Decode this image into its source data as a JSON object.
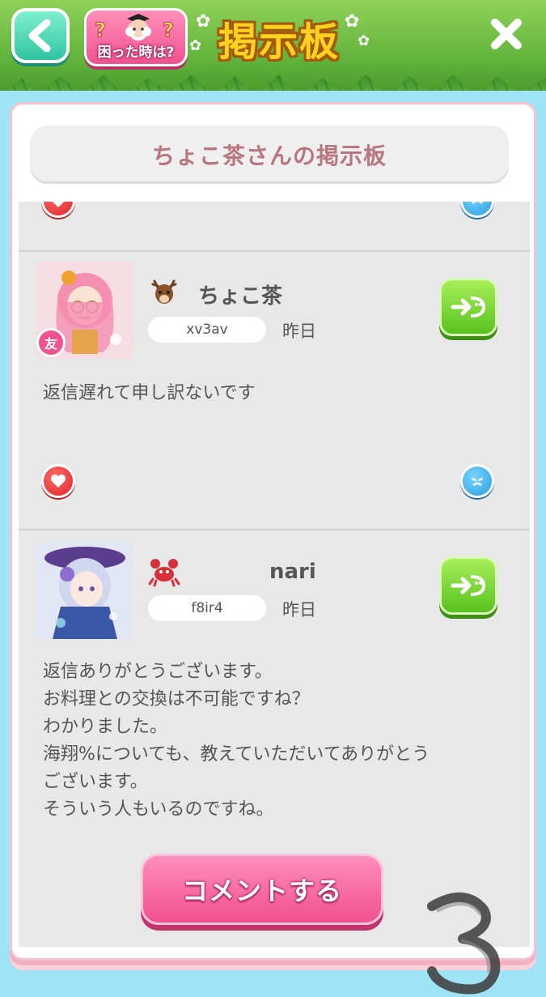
{
  "header": {
    "help_label": "困った時は?",
    "title": "掲示板"
  },
  "panel": {
    "title": "ちょこ茶さんの掲示板"
  },
  "posts": [
    {
      "username": "ちょこ茶",
      "user_id": "xv3av",
      "timestamp": "昨日",
      "friend_badge": "友",
      "zodiac_icon": "deer-icon",
      "message": "返信遅れて申し訳ないです"
    },
    {
      "username": "nari",
      "user_id": "f8ir4",
      "timestamp": "昨日",
      "zodiac_icon": "crab-icon",
      "message": "返信ありがとうございます。\nお料理との交換は不可能ですね？\nわかりました。\n海翔%についても、教えていただいてありがとう\nございます。\nそういう人もいるのですね。"
    }
  ],
  "comment_button": "コメントする",
  "overlay_mark": "3",
  "colors": {
    "accent_pink": "#f24f8f",
    "reply_green": "#59c21f",
    "title_text": "#b8767e"
  }
}
